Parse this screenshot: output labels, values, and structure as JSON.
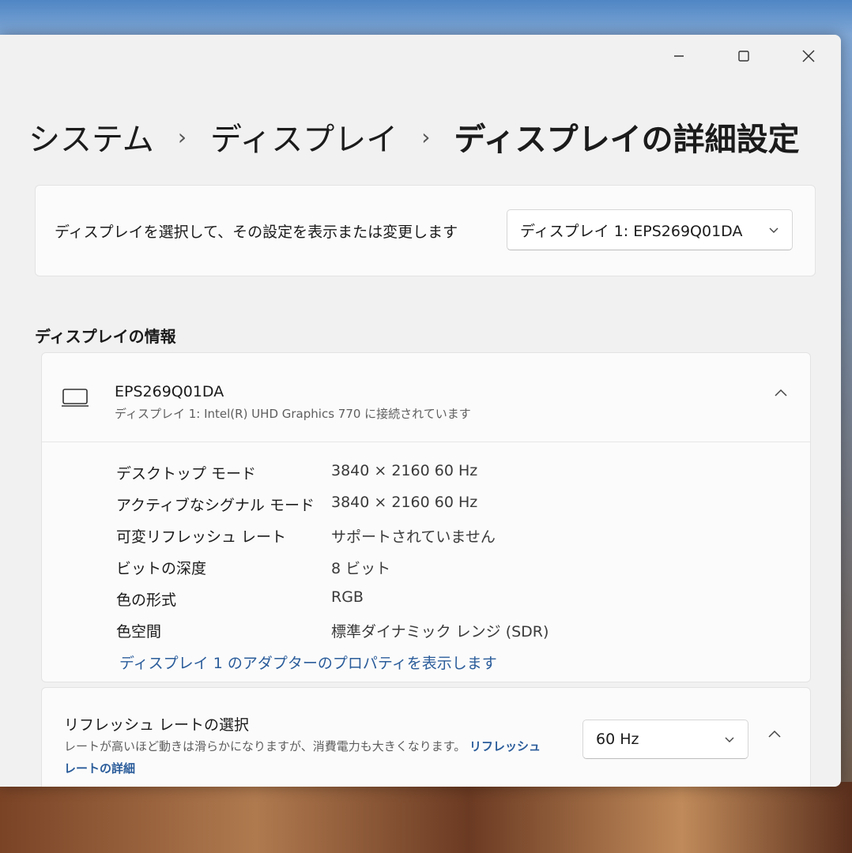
{
  "window": {
    "caption": {
      "minimize_icon": "minimize-icon",
      "maximize_icon": "maximize-icon",
      "close_icon": "close-icon"
    }
  },
  "breadcrumb": {
    "items": [
      "システム",
      "ディスプレイ",
      "ディスプレイの詳細設定"
    ],
    "separator": "›"
  },
  "display_select": {
    "label": "ディスプレイを選択して、その設定を表示または変更します",
    "selected": "ディスプレイ 1: EPS269Q01DA"
  },
  "display_info": {
    "section_title": "ディスプレイの情報",
    "name": "EPS269Q01DA",
    "subtitle": "ディスプレイ 1: Intel(R) UHD Graphics 770 に接続されています",
    "specs": [
      {
        "label": "デスクトップ モード",
        "value": "3840 × 2160 60 Hz"
      },
      {
        "label": "アクティブなシグナル モード",
        "value": "3840 × 2160 60 Hz"
      },
      {
        "label": "可変リフレッシュ レート",
        "value": "サポートされていません"
      },
      {
        "label": "ビットの深度",
        "value": "8 ビット"
      },
      {
        "label": "色の形式",
        "value": "RGB"
      },
      {
        "label": "色空間",
        "value": "標準ダイナミック レンジ (SDR)"
      }
    ],
    "adapter_link": "ディスプレイ 1 のアダプターのプロパティを表示します"
  },
  "refresh_rate": {
    "title": "リフレッシュ レートの選択",
    "description": "レートが高いほど動きは滑らかになりますが、消費電力も大きくなります。",
    "link": "リフレッシュ レートの詳細",
    "selected": "60 Hz"
  },
  "colors": {
    "window_bg": "#f1f1f1",
    "card_bg": "#fbfbfb",
    "link": "#2a5c9a",
    "text_primary": "#1b1b1b",
    "text_secondary": "#5e5e5e"
  }
}
